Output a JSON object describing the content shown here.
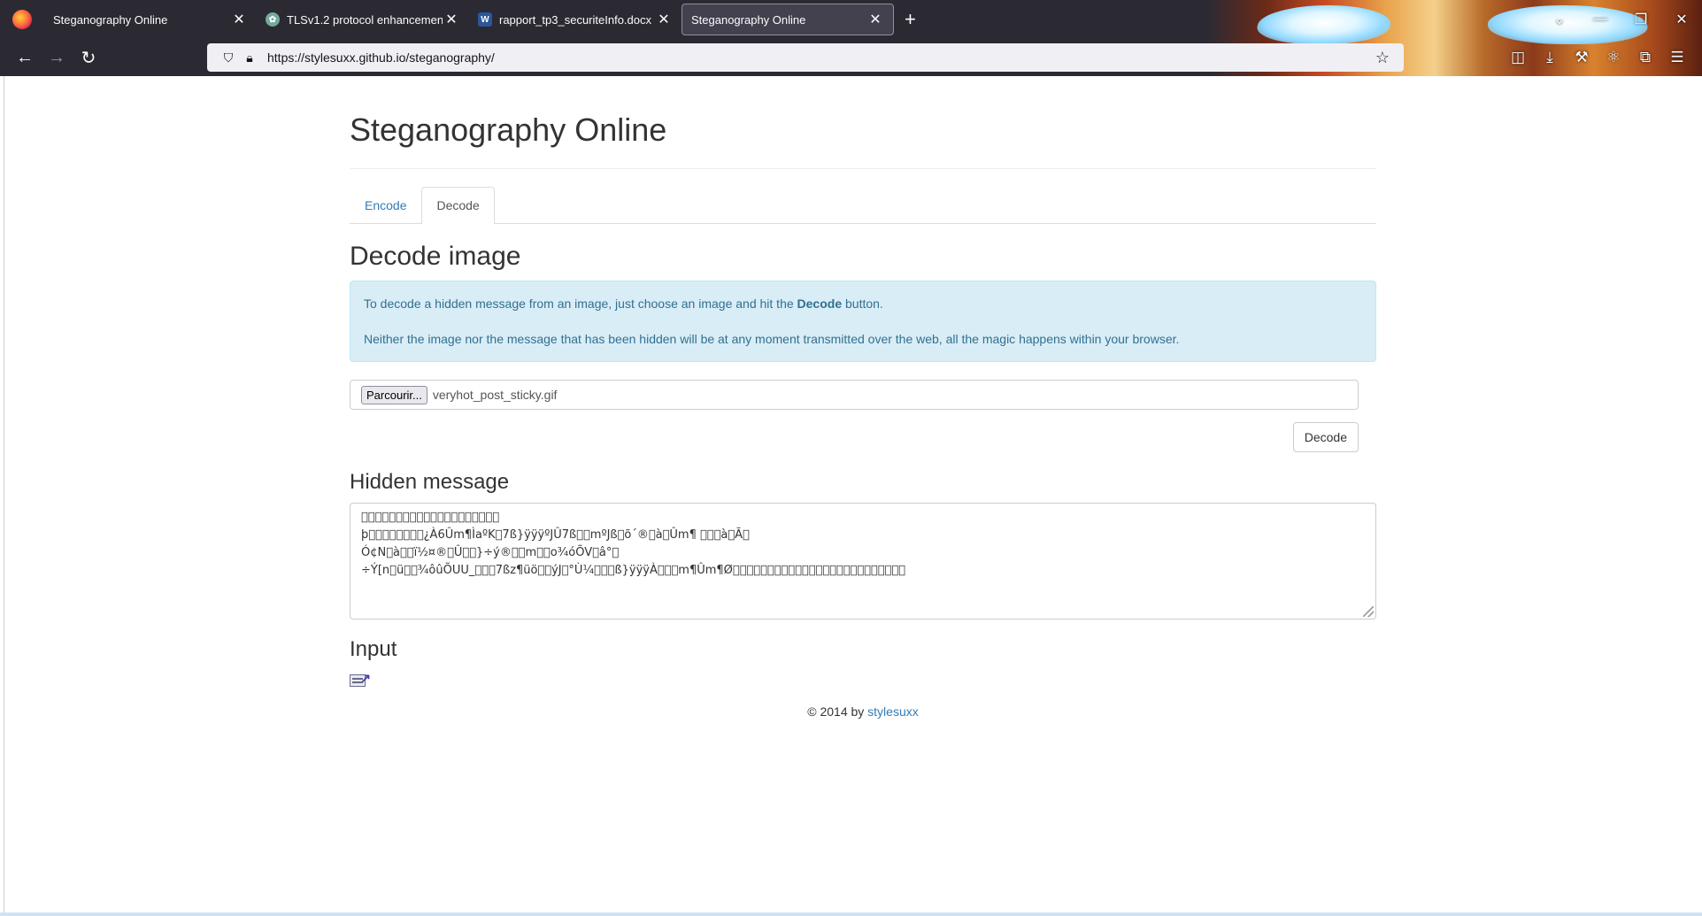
{
  "browser": {
    "tabs": [
      {
        "title": "Steganography Online",
        "favicon": "firefox-icon",
        "active": false
      },
      {
        "title": "TLSv1.2 protocol enhancement",
        "favicon": "chatgpt-icon",
        "active": false
      },
      {
        "title": "rapport_tp3_securiteInfo.docx",
        "favicon": "word-icon",
        "active": false
      },
      {
        "title": "Steganography Online",
        "favicon": "none",
        "active": true
      }
    ],
    "url": "https://stylesuxx.github.io/steganography/"
  },
  "page": {
    "title": "Steganography Online",
    "tabs": [
      {
        "label": "Encode",
        "active": false
      },
      {
        "label": "Decode",
        "active": true
      }
    ],
    "decode": {
      "heading": "Decode image",
      "info_p1_before": "To decode a hidden message from an image, just choose an image and hit the ",
      "info_p1_bold": "Decode",
      "info_p1_after": " button.",
      "info_p2": "Neither the image nor the message that has been hidden will be at any moment transmitted over the web, all the magic happens within your browser.",
      "file_button": "Parcourir...",
      "file_name": "veryhot_post_sticky.gif",
      "decode_button": "Decode"
    },
    "hidden_message": {
      "heading": "Hidden message",
      "lines": [
        "\u0000\u0000\u0000\u0000\u0000\u0000\u0000\u0000\u0000\u0000\u0000\u0000\u0000\u0000\u0000\u0000\u0000\u0000\u0000\u0000",
        "þ\u0000\u0000\u0000\u0000\u0000\u0000\u0000\u0000¿À6Ûm¶ÌaºK\u00007ß}ÿÿÿºJÛ7ß\u0000\u0000mºJß\u0000õ´®\u0000à\u0000Ûm¶ \u0000\u0000\u0000à\u0000Ã\u0000",
        "Ó¢N\u0000à\u0000\u0000ï½¤®\u0000Û\u0000\u0000}÷ý®\u0000\u0000m\u0000\u0000o¾óÕV\u0000â°\u0000",
        "÷Ý[n\u0000ü\u0000\u0000¾ôûÕUU_\u0000\u0000\u00007ßz¶üö\u0000\u0000ýJ\u0000°Ù¼\u0000\u0000\u0000ß}ÿÿÿÀ\u0000\u0000\u0000m¶Ûm¶Ø\u0000\u0000\u0000\u0000\u0000\u0000\u0000\u0000\u0000\u0000\u0000\u0000\u0000\u0000\u0000\u0000\u0000\u0000\u0000\u0000\u0000\u0000\u0000\u0000\u0000"
      ]
    },
    "input": {
      "heading": "Input"
    },
    "footer": {
      "prefix": "© 2014 by ",
      "link": "stylesuxx"
    }
  }
}
